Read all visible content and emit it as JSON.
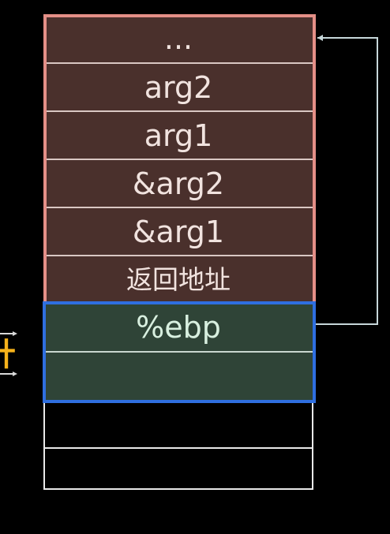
{
  "diagram": {
    "caller_frame": {
      "cells": [
        "...",
        "arg2",
        "arg1",
        "&arg2",
        "&arg1",
        "返回地址"
      ]
    },
    "callee_frame": {
      "cells": [
        "%ebp",
        ""
      ]
    },
    "side_label": "针",
    "colors": {
      "caller_fill": "#4a302c",
      "caller_border": "#e48f87",
      "callee_fill": "#2f4437",
      "callee_border": "#2f6fe0",
      "arrow": "#c7d7da",
      "label": "#f6b21b"
    }
  }
}
